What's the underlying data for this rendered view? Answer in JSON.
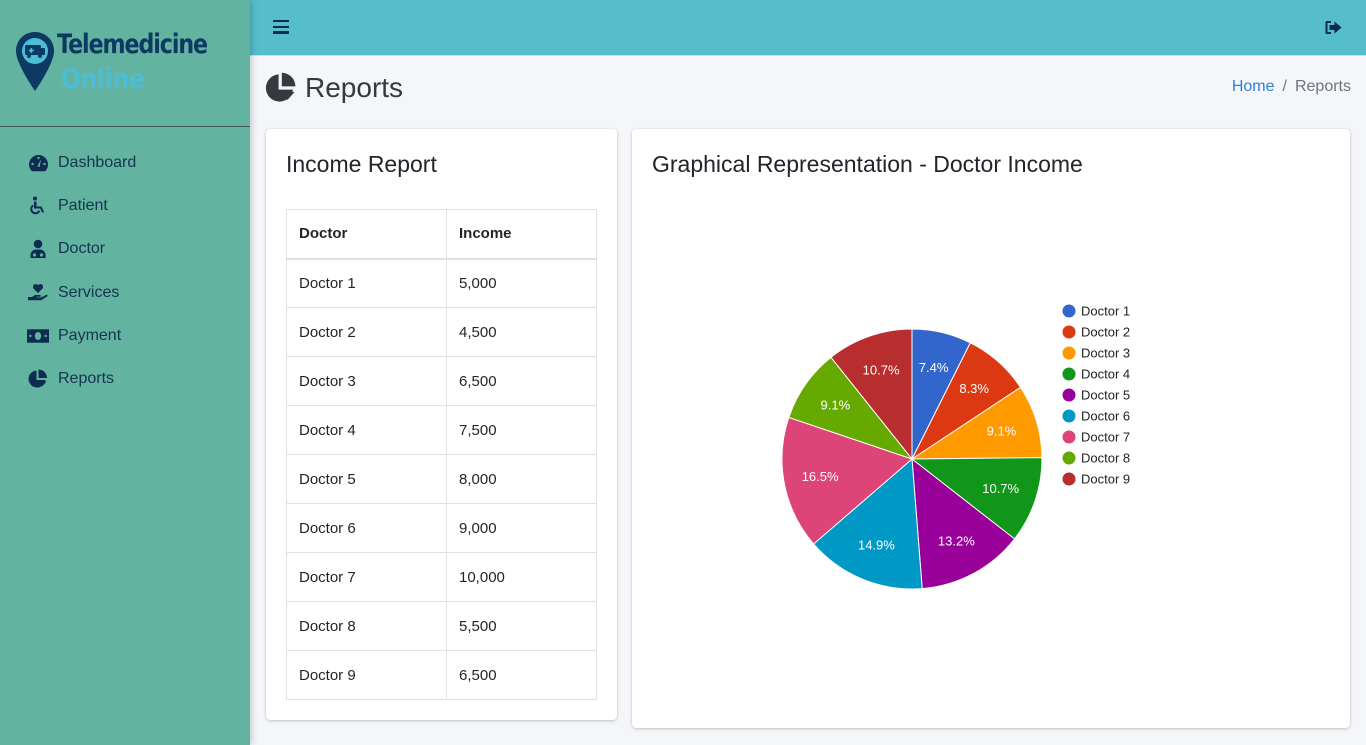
{
  "app": {
    "brand_line1": "Telemedicine",
    "brand_line2": "Online",
    "logo_icon": "map-pin-ambulance-icon"
  },
  "sidebar": {
    "items": [
      {
        "label": "Dashboard",
        "icon": "tachometer-icon"
      },
      {
        "label": "Patient",
        "icon": "wheelchair-icon"
      },
      {
        "label": "Doctor",
        "icon": "user-md-icon"
      },
      {
        "label": "Services",
        "icon": "hand-holding-heart-icon"
      },
      {
        "label": "Payment",
        "icon": "money-bill-icon"
      },
      {
        "label": "Reports",
        "icon": "chart-pie-icon"
      }
    ]
  },
  "topbar": {
    "menu_icon": "hamburger-menu-icon",
    "logout_icon": "sign-out-icon"
  },
  "page": {
    "title": "Reports",
    "title_icon": "chart-pie-icon",
    "breadcrumb": [
      {
        "label": "Home",
        "link": true
      },
      {
        "label": "Reports",
        "link": false
      }
    ]
  },
  "income_report": {
    "title": "Income Report",
    "columns": [
      "Doctor",
      "Income"
    ],
    "rows": [
      [
        "Doctor 1",
        "5,000"
      ],
      [
        "Doctor 2",
        "4,500"
      ],
      [
        "Doctor 3",
        "6,500"
      ],
      [
        "Doctor 4",
        "7,500"
      ],
      [
        "Doctor 5",
        "8,000"
      ],
      [
        "Doctor 6",
        "9,000"
      ],
      [
        "Doctor 7",
        "10,000"
      ],
      [
        "Doctor 8",
        "5,500"
      ],
      [
        "Doctor 9",
        "6,500"
      ]
    ]
  },
  "chart_data": {
    "type": "pie",
    "title": "Graphical Representation - Doctor Income",
    "categories": [
      "Doctor 1",
      "Doctor 2",
      "Doctor 3",
      "Doctor 4",
      "Doctor 5",
      "Doctor 6",
      "Doctor 7",
      "Doctor 8",
      "Doctor 9"
    ],
    "values": [
      7.4,
      8.3,
      9.1,
      10.7,
      13.2,
      14.9,
      16.5,
      9.1,
      10.7
    ],
    "labels": [
      "7.4%",
      "8.3%",
      "9.1%",
      "10.7%",
      "13.2%",
      "14.9%",
      "16.5%",
      "9.1%",
      "10.7%"
    ],
    "colors": [
      "#3366cc",
      "#dc3912",
      "#ff9900",
      "#109618",
      "#990099",
      "#0099c6",
      "#dd4477",
      "#66aa00",
      "#b82e2e"
    ],
    "unit": "percent",
    "legend_position": "right"
  }
}
